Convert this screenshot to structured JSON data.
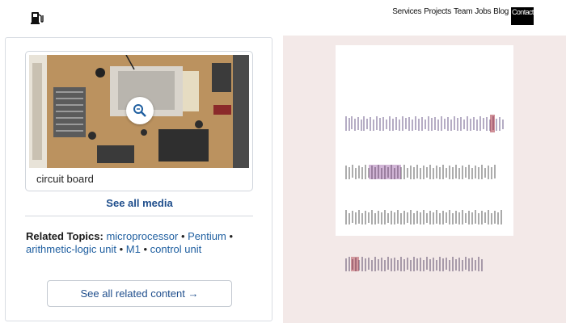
{
  "header": {
    "logo_icon": "gas-pump-icon",
    "nav": [
      "Services",
      "Projects",
      "Team",
      "Jobs",
      "Blog"
    ],
    "contact_label": "Contact"
  },
  "media": {
    "caption": "circuit board",
    "zoom_icon": "magnifier-icon",
    "see_all_label": "See all media"
  },
  "related": {
    "label": "Related Topics:",
    "topics": [
      "microprocessor",
      "Pentium",
      "arithmetic-logic unit",
      "M1",
      "control unit"
    ],
    "see_all_label": "See all related content →"
  },
  "colors": {
    "link": "#1f5fa0",
    "accent": "#1f4e8c",
    "right_bg": "#f3e9e8"
  }
}
